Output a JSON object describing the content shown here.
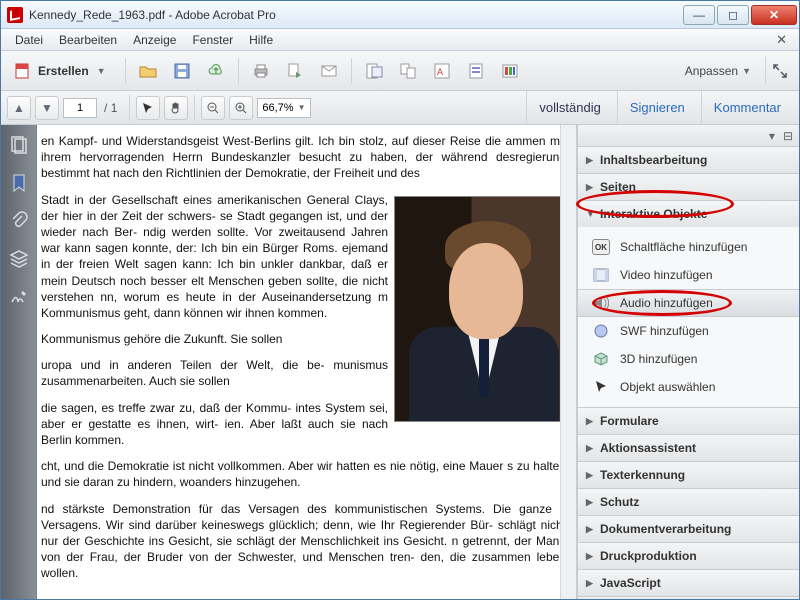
{
  "window": {
    "title": "Kennedy_Rede_1963.pdf - Adobe Acrobat Pro"
  },
  "menu": {
    "items": [
      "Datei",
      "Bearbeiten",
      "Anzeige",
      "Fenster",
      "Hilfe"
    ]
  },
  "toolbar": {
    "create_label": "Erstellen",
    "anpassen": "Anpassen"
  },
  "nav": {
    "page_current": "1",
    "page_sep": "/",
    "page_total": "1",
    "zoom": "66,7%",
    "tabs": {
      "voll": "vollständig",
      "sign": "Signieren",
      "komm": "Kommentar"
    }
  },
  "doc": {
    "p1": "en Kampf- und Widerstandsgeist West-Berlins gilt. Ich bin stolz, auf dieser Reise die ammen mit ihrem hervorragenden Herrn Bundeskanzler besucht zu haben, der während desregierung bestimmt hat nach den Richtlinien der Demokratie, der Freiheit und des",
    "p2": "Stadt in der Gesellschaft eines amerikanischen General Clays, der hier in der Zeit der schwers- se Stadt gegangen ist, und der wieder nach Ber- ndig werden sollte. Vor zweitausend Jahren war kann sagen konnte, der: Ich bin ein Bürger Roms. ejemand in der freien Welt sagen kann: Ich bin unkler dankbar, daß er mein Deutsch noch besser elt Menschen geben sollte, die nicht verstehen nn, worum es heute in der Auseinandersetzung m Kommunismus geht, dann können wir ihnen kommen.",
    "p3": "Kommunismus gehöre die Zukunft. Sie sollen",
    "p4": "uropa und in anderen Teilen der Welt, die be- munismus zusammenarbeiten. Auch sie sollen",
    "p5": "die sagen, es treffe zwar zu, daß der Kommu- intes System sei, aber er gestatte es ihnen, wirt- ien. Aber laßt auch sie nach Berlin kommen.",
    "p6": "cht, und die Demokratie ist nicht vollkommen. Aber wir hatten es nie nötig, eine Mauer s zu halten und sie daran zu hindern, woanders hinzugehen.",
    "p7": "nd stärkste Demonstration für das Versagen des kommunistischen Systems. Die ganze s Versagens. Wir sind darüber keineswegs glücklich; denn, wie Ihr Regierender Bür- schlägt nicht nur der Geschichte ins Gesicht, sie schlägt der Menschlichkeit ins Gesicht. n getrennt, der Mann von der Frau, der Bruder von der Schwester, und Menschen tren- den, die zusammen leben wollen."
  },
  "panel": {
    "sections": {
      "inhalt": "Inhaltsbearbeitung",
      "seiten": "Seiten",
      "interaktiv": "Interaktive Objekte",
      "formulare": "Formulare",
      "aktions": "Aktionsassistent",
      "texterk": "Texterkennung",
      "schutz": "Schutz",
      "dokverarb": "Dokumentverarbeitung",
      "druck": "Druckproduktion",
      "js": "JavaScript"
    },
    "tools": {
      "schalt": "Schaltfläche hinzufügen",
      "video": "Video hinzufügen",
      "audio": "Audio hinzufügen",
      "swf": "SWF hinzufügen",
      "dreid": "3D hinzufügen",
      "objaus": "Objekt auswählen"
    },
    "ok_icon": "OK"
  }
}
